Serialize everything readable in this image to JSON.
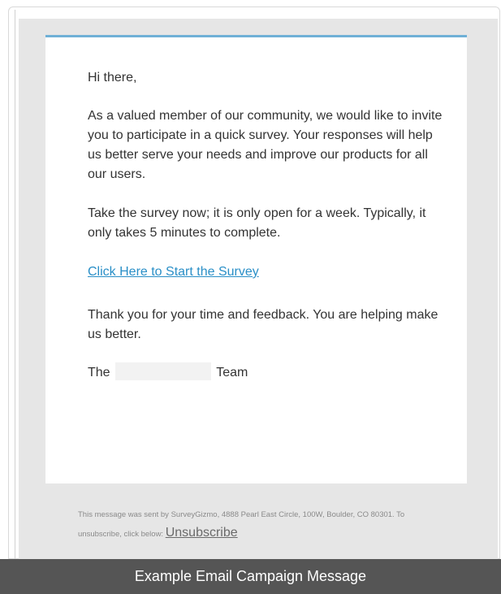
{
  "email": {
    "greeting": "Hi there,",
    "paragraph1": "As a valued member of our community, we would like to invite you to participate in a quick survey. Your responses will help us better serve your needs and improve our products for all our users.",
    "paragraph2": "Take the survey now; it is only open for a week. Typically, it only takes 5 minutes to complete.",
    "survey_link": "Click Here to Start the Survey",
    "paragraph3": "Thank you for your time and feedback. You are helping make us better.",
    "signature_prefix": "The",
    "signature_suffix": "Team"
  },
  "footer": {
    "text": "This message was sent by SurveyGizmo, 4888 Pearl East Circle, 100W, Boulder, CO 80301. To unsubscribe, click below:",
    "unsubscribe_label": "Unsubscribe"
  },
  "caption": "Example Email Campaign Message",
  "colors": {
    "accent": "#6fb0d6",
    "link": "#2a8fc7",
    "background": "#e6e6e6",
    "caption_bar": "#555555"
  }
}
